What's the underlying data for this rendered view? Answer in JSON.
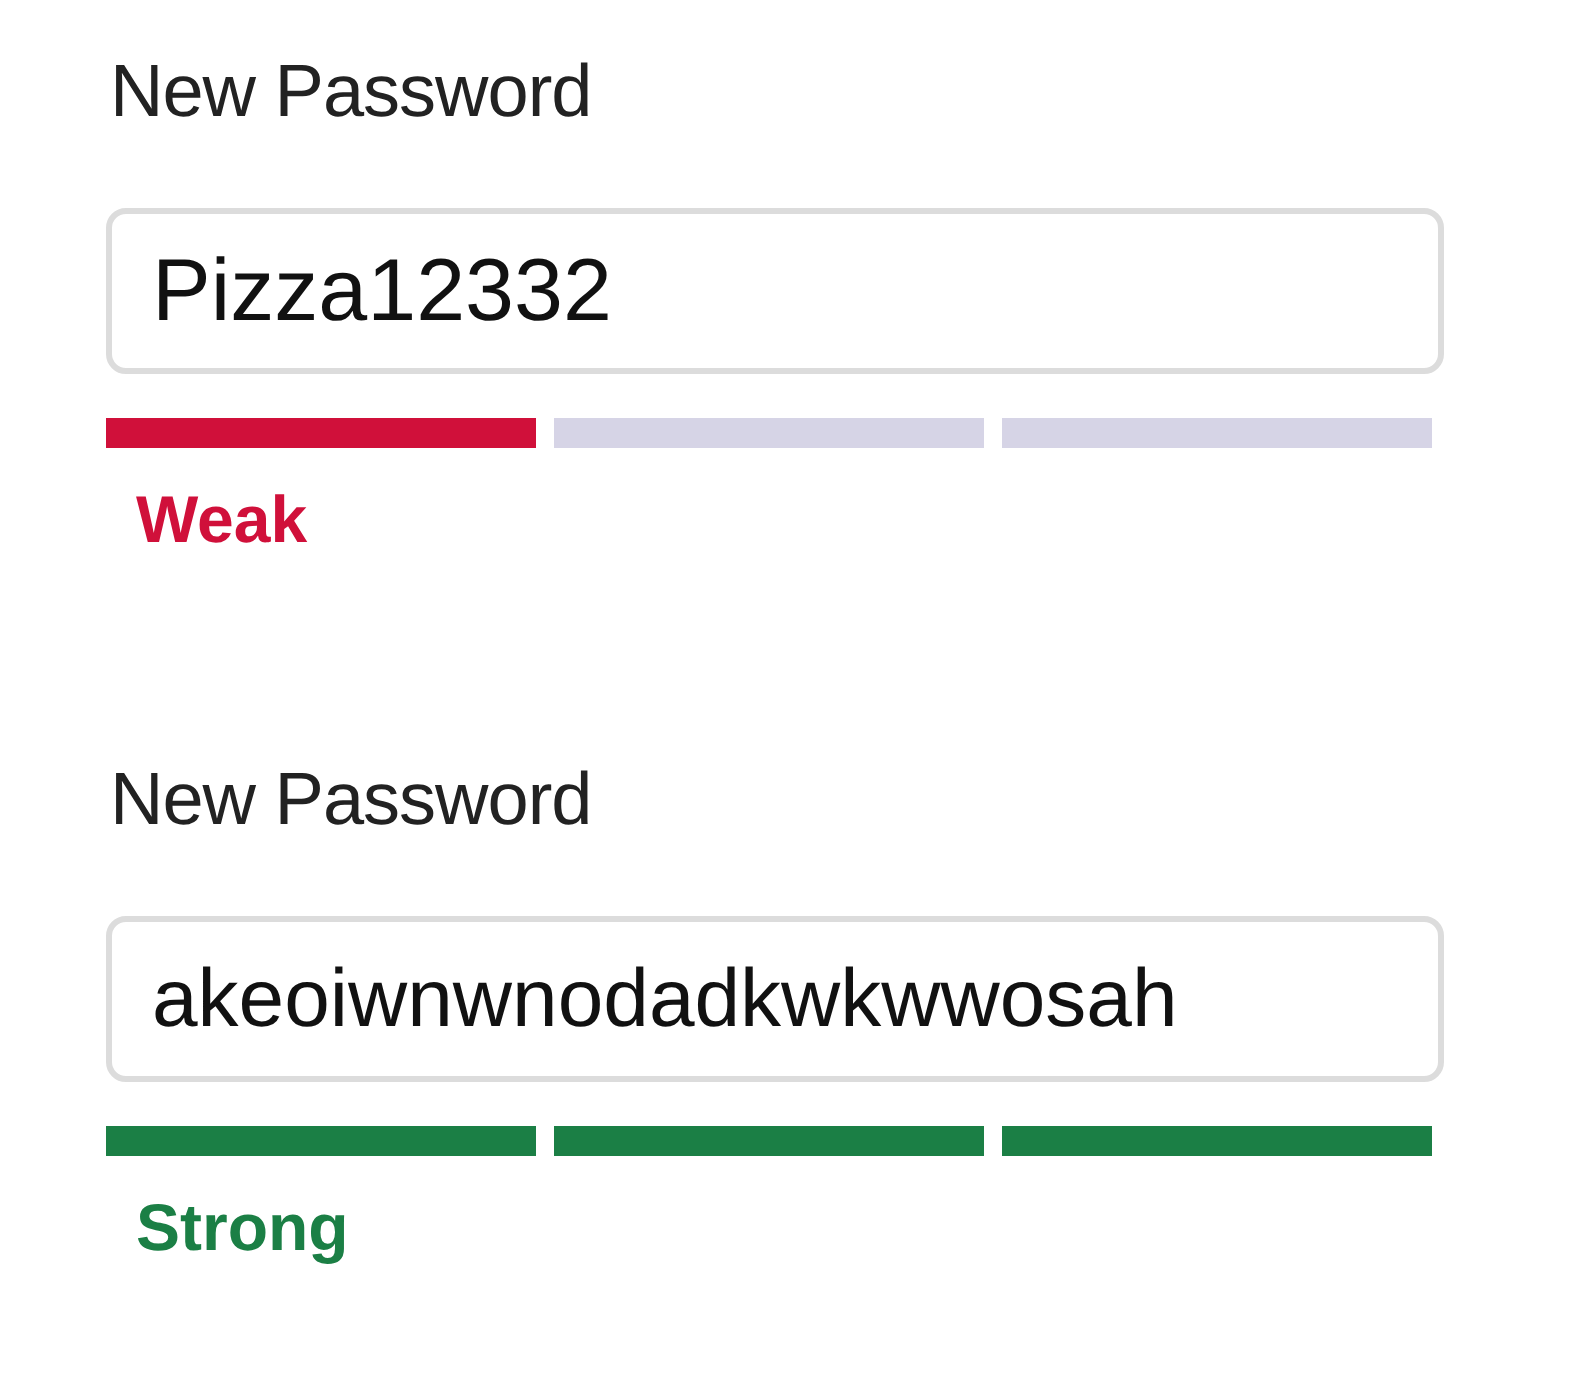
{
  "fields": [
    {
      "label": "New Password",
      "value": "Pizza12332",
      "strength_label": "Weak",
      "color": "#d0103a",
      "bars": [
        {
          "on": true
        },
        {
          "on": false
        },
        {
          "on": false
        }
      ]
    },
    {
      "label": "New Password",
      "value": "akeoiwnwnodadkwkwwosah",
      "strength_label": "Strong",
      "color": "#1b7f45",
      "bars": [
        {
          "on": true
        },
        {
          "on": true
        },
        {
          "on": true
        }
      ]
    }
  ]
}
